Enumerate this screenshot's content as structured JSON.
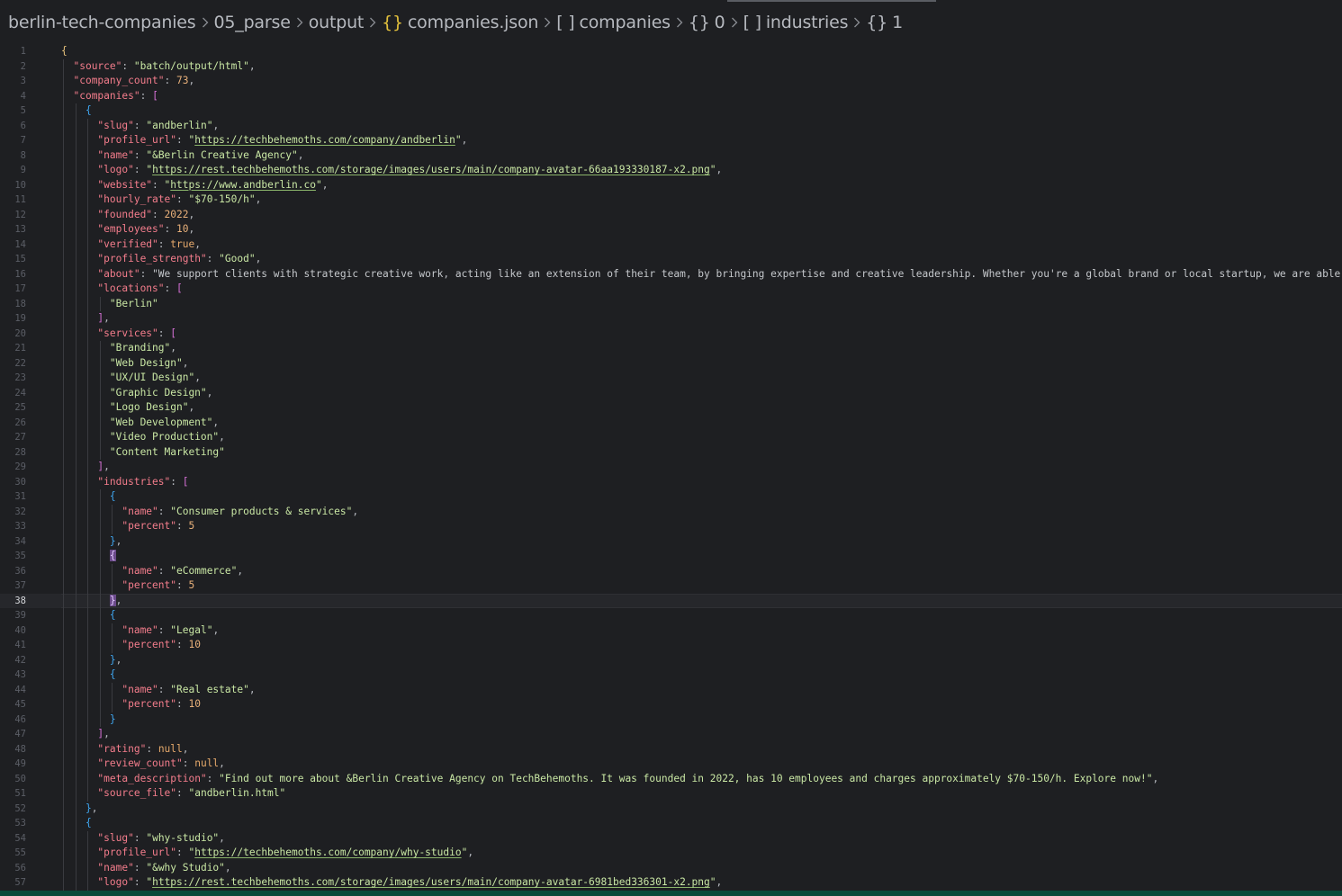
{
  "breadcrumb": {
    "items": [
      {
        "label": "berlin-tech-companies",
        "icon": ""
      },
      {
        "label": "05_parse",
        "icon": ""
      },
      {
        "label": "output",
        "icon": ""
      },
      {
        "label": "companies.json",
        "icon": "{}"
      },
      {
        "label": "companies",
        "icon": "[ ]"
      },
      {
        "label": "0",
        "icon": "{}"
      },
      {
        "label": "industries",
        "icon": "[ ]"
      },
      {
        "label": "1",
        "icon": "{}"
      }
    ]
  },
  "editor": {
    "current_line": 38,
    "lines": [
      {
        "n": "1",
        "t": "{"
      },
      {
        "n": "2",
        "t": "  \"source\": \"batch/output/html\","
      },
      {
        "n": "3",
        "t": "  \"company_count\": 73,"
      },
      {
        "n": "4",
        "t": "  \"companies\": ["
      },
      {
        "n": "5",
        "t": "    {"
      },
      {
        "n": "6",
        "t": "      \"slug\": \"andberlin\","
      },
      {
        "n": "7",
        "t": "      \"profile_url\": \"https://techbehemoths.com/company/andberlin\","
      },
      {
        "n": "8",
        "t": "      \"name\": \"&Berlin Creative Agency\","
      },
      {
        "n": "9",
        "t": "      \"logo\": \"https://rest.techbehemoths.com/storage/images/users/main/company-avatar-66aa193330187-x2.png\","
      },
      {
        "n": "10",
        "t": "      \"website\": \"https://www.andberlin.co\","
      },
      {
        "n": "11",
        "t": "      \"hourly_rate\": \"$70-150/h\","
      },
      {
        "n": "12",
        "t": "      \"founded\": 2022,"
      },
      {
        "n": "13",
        "t": "      \"employees\": 10,"
      },
      {
        "n": "14",
        "t": "      \"verified\": true,"
      },
      {
        "n": "15",
        "t": "      \"profile_strength\": \"Good\","
      },
      {
        "n": "16",
        "t": "      \"about\": \"We support clients with strategic creative work, acting like an extension of their team, by bringing expertise and creative leadership. Whether you're a global brand or local startup, we are able to s"
      },
      {
        "n": "17",
        "t": "      \"locations\": ["
      },
      {
        "n": "18",
        "t": "        \"Berlin\""
      },
      {
        "n": "19",
        "t": "      ],"
      },
      {
        "n": "20",
        "t": "      \"services\": ["
      },
      {
        "n": "21",
        "t": "        \"Branding\","
      },
      {
        "n": "22",
        "t": "        \"Web Design\","
      },
      {
        "n": "23",
        "t": "        \"UX/UI Design\","
      },
      {
        "n": "24",
        "t": "        \"Graphic Design\","
      },
      {
        "n": "25",
        "t": "        \"Logo Design\","
      },
      {
        "n": "26",
        "t": "        \"Web Development\","
      },
      {
        "n": "27",
        "t": "        \"Video Production\","
      },
      {
        "n": "28",
        "t": "        \"Content Marketing\""
      },
      {
        "n": "29",
        "t": "      ],"
      },
      {
        "n": "30",
        "t": "      \"industries\": ["
      },
      {
        "n": "31",
        "t": "        {"
      },
      {
        "n": "32",
        "t": "          \"name\": \"Consumer products & services\","
      },
      {
        "n": "33",
        "t": "          \"percent\": 5"
      },
      {
        "n": "34",
        "t": "        },"
      },
      {
        "n": "35",
        "t": "        {"
      },
      {
        "n": "36",
        "t": "          \"name\": \"eCommerce\","
      },
      {
        "n": "37",
        "t": "          \"percent\": 5"
      },
      {
        "n": "38",
        "t": "        },"
      },
      {
        "n": "39",
        "t": "        {"
      },
      {
        "n": "40",
        "t": "          \"name\": \"Legal\","
      },
      {
        "n": "41",
        "t": "          \"percent\": 10"
      },
      {
        "n": "42",
        "t": "        },"
      },
      {
        "n": "43",
        "t": "        {"
      },
      {
        "n": "44",
        "t": "          \"name\": \"Real estate\","
      },
      {
        "n": "45",
        "t": "          \"percent\": 10"
      },
      {
        "n": "46",
        "t": "        }"
      },
      {
        "n": "47",
        "t": "      ],"
      },
      {
        "n": "48",
        "t": "      \"rating\": null,"
      },
      {
        "n": "49",
        "t": "      \"review_count\": null,"
      },
      {
        "n": "50",
        "t": "      \"meta_description\": \"Find out more about &Berlin Creative Agency on TechBehemoths. It was founded in 2022, has 10 employees and charges approximately $70-150/h. Explore now!\","
      },
      {
        "n": "51",
        "t": "      \"source_file\": \"andberlin.html\""
      },
      {
        "n": "52",
        "t": "    },"
      },
      {
        "n": "53",
        "t": "    {"
      },
      {
        "n": "54",
        "t": "      \"slug\": \"why-studio\","
      },
      {
        "n": "55",
        "t": "      \"profile_url\": \"https://techbehemoths.com/company/why-studio\","
      },
      {
        "n": "56",
        "t": "      \"name\": \"&why Studio\","
      },
      {
        "n": "57",
        "t": "      \"logo\": \"https://rest.techbehemoths.com/storage/images/users/main/company-avatar-6981bed336301-x2.png\","
      }
    ]
  },
  "colors": {
    "background": "#1e1f22",
    "key": "#f47d8c",
    "string": "#c9e7a4",
    "number": "#e8b07a",
    "status_bar": "#0a4a3a"
  }
}
